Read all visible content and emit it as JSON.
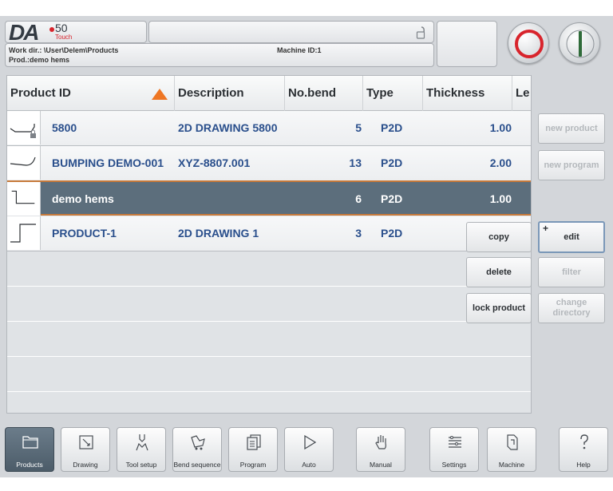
{
  "header": {
    "logo_text": "DA",
    "logo_number": "50",
    "logo_touch": "Touch",
    "work_dir": "Work dir.: \\User\\Delem\\Products",
    "product": "Prod.:demo hems",
    "machine_id": "Machine ID:1"
  },
  "table": {
    "columns": [
      "Product ID",
      "Description",
      "No.bend",
      "Type",
      "Thickness",
      "Le"
    ],
    "sort_column": "Product ID",
    "rows": [
      {
        "id": "5800",
        "description": "2D DRAWING 5800",
        "bends": "5",
        "type": "P2D",
        "thickness": "1.00",
        "thumb": "locked-profile-icon"
      },
      {
        "id": "BUMPING DEMO-001",
        "description": "XYZ-8807.001",
        "bends": "13",
        "type": "P2D",
        "thickness": "2.00",
        "thumb": "curve-profile-icon"
      },
      {
        "id": "demo hems",
        "description": "",
        "bends": "6",
        "type": "P2D",
        "thickness": "1.00",
        "thumb": "hem-profile-icon",
        "selected": true
      },
      {
        "id": "PRODUCT-1",
        "description": "2D DRAWING 1",
        "bends": "3",
        "type": "P2D",
        "thickness": "",
        "thumb": "step-profile-icon"
      }
    ]
  },
  "side_buttons": {
    "new_product": "new product",
    "new_program": "new program",
    "copy": "copy",
    "edit": "edit",
    "edit_plus": "+",
    "delete": "delete",
    "filter": "filter",
    "lock_product": "lock product",
    "change_directory": "change directory"
  },
  "nav": [
    {
      "label": "Products",
      "icon": "folder-icon",
      "active": true
    },
    {
      "label": "Drawing",
      "icon": "pencil-icon"
    },
    {
      "label": "Tool setup",
      "icon": "tool-icon"
    },
    {
      "label": "Bend sequence",
      "icon": "bend-sequence-icon"
    },
    {
      "label": "Program",
      "icon": "program-icon"
    },
    {
      "label": "Auto",
      "icon": "play-icon"
    },
    {
      "label": "Manual",
      "icon": "hand-icon"
    },
    {
      "label": "Settings",
      "icon": "settings-list-icon"
    },
    {
      "label": "Machine",
      "icon": "machine-icon"
    },
    {
      "label": "Help",
      "icon": "question-icon"
    }
  ],
  "colors": {
    "accent_orange": "#ee7623",
    "selected_row": "#5c6e7c",
    "stop_red": "#d8242c",
    "start_green": "#2f6b3a",
    "text_blue": "#2a4f8c"
  }
}
